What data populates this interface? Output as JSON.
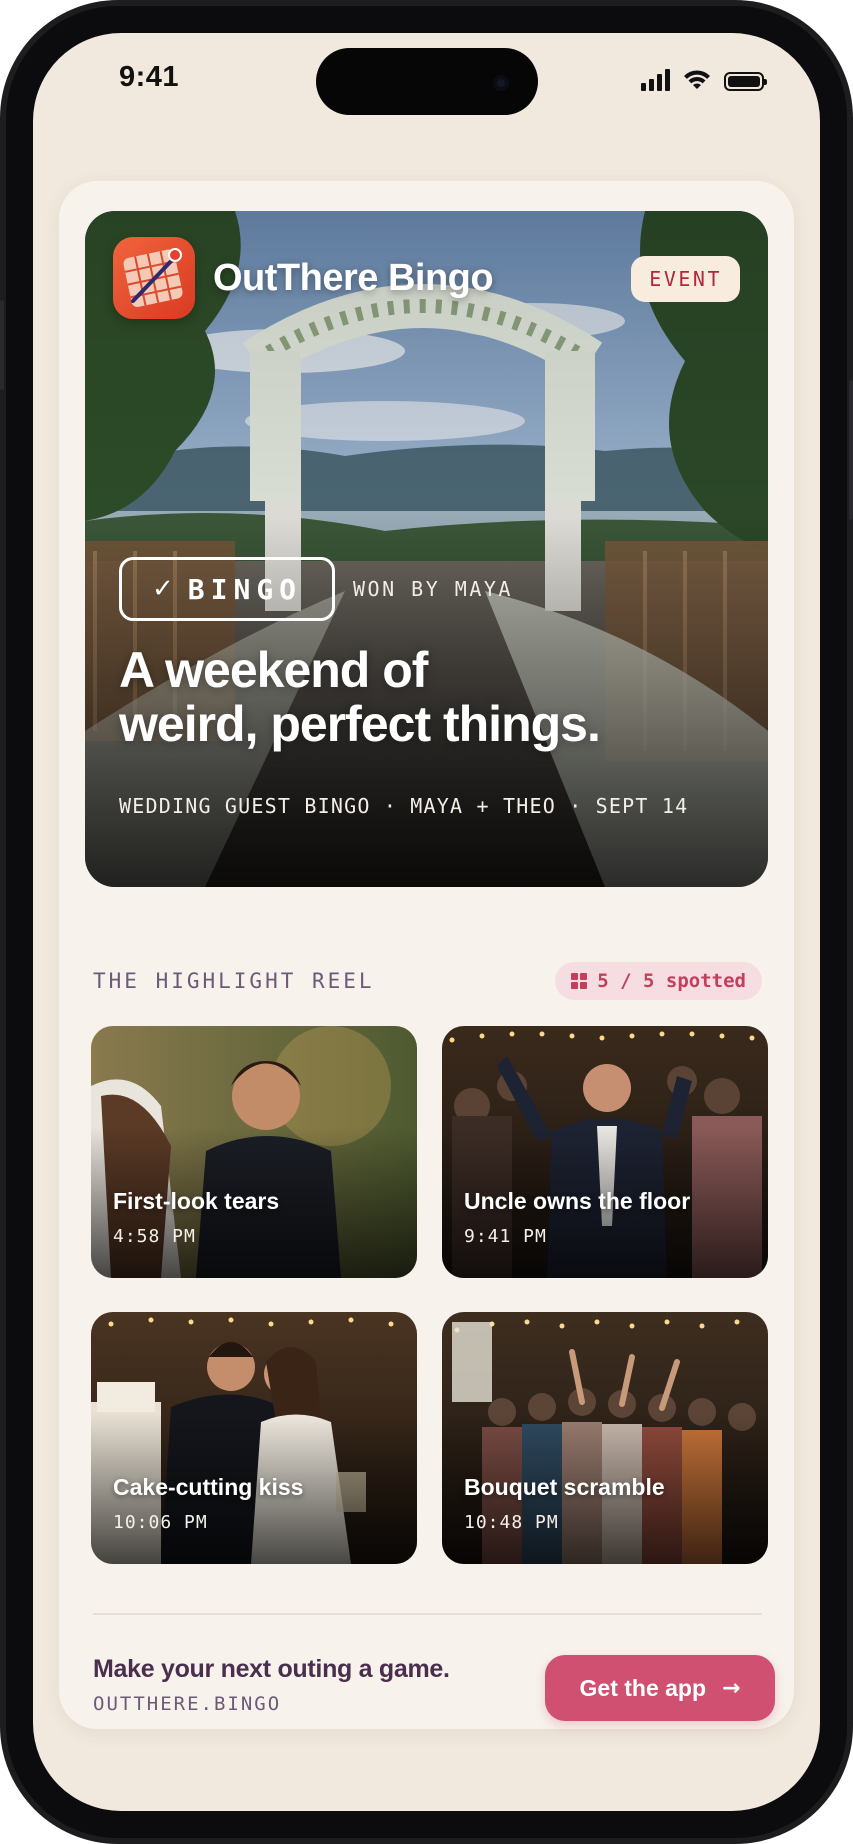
{
  "status_bar": {
    "time": "9:41"
  },
  "hero": {
    "brand": "OutThere Bingo",
    "badge": "EVENT",
    "bingo_label": "BINGO",
    "bingo_check": "✓",
    "won_by": "WON BY MAYA",
    "title_line1": "A weekend of",
    "title_line2": "weird, perfect things.",
    "subtitle": "WEDDING GUEST BINGO · MAYA + THEO · SEPT 14"
  },
  "reel": {
    "title": "THE HIGHLIGHT REEL",
    "spotted": "5 / 5 spotted",
    "tiles": [
      {
        "title": "First-look tears",
        "time": "4:58 PM"
      },
      {
        "title": "Uncle owns the floor",
        "time": "9:41 PM"
      },
      {
        "title": "Cake-cutting kiss",
        "time": "10:06 PM"
      },
      {
        "title": "Bouquet scramble",
        "time": "10:48 PM"
      }
    ]
  },
  "cta": {
    "title": "Make your next outing a game.",
    "url": "OUTTHERE.BINGO",
    "button": "Get the app",
    "button_icon": "→"
  },
  "colors": {
    "screen_bg": "#f1e9dd",
    "card_bg": "#f7f2ec",
    "accent": "#cf5070",
    "badge_text": "#b3263e",
    "muted_purple": "#6c5a78"
  }
}
